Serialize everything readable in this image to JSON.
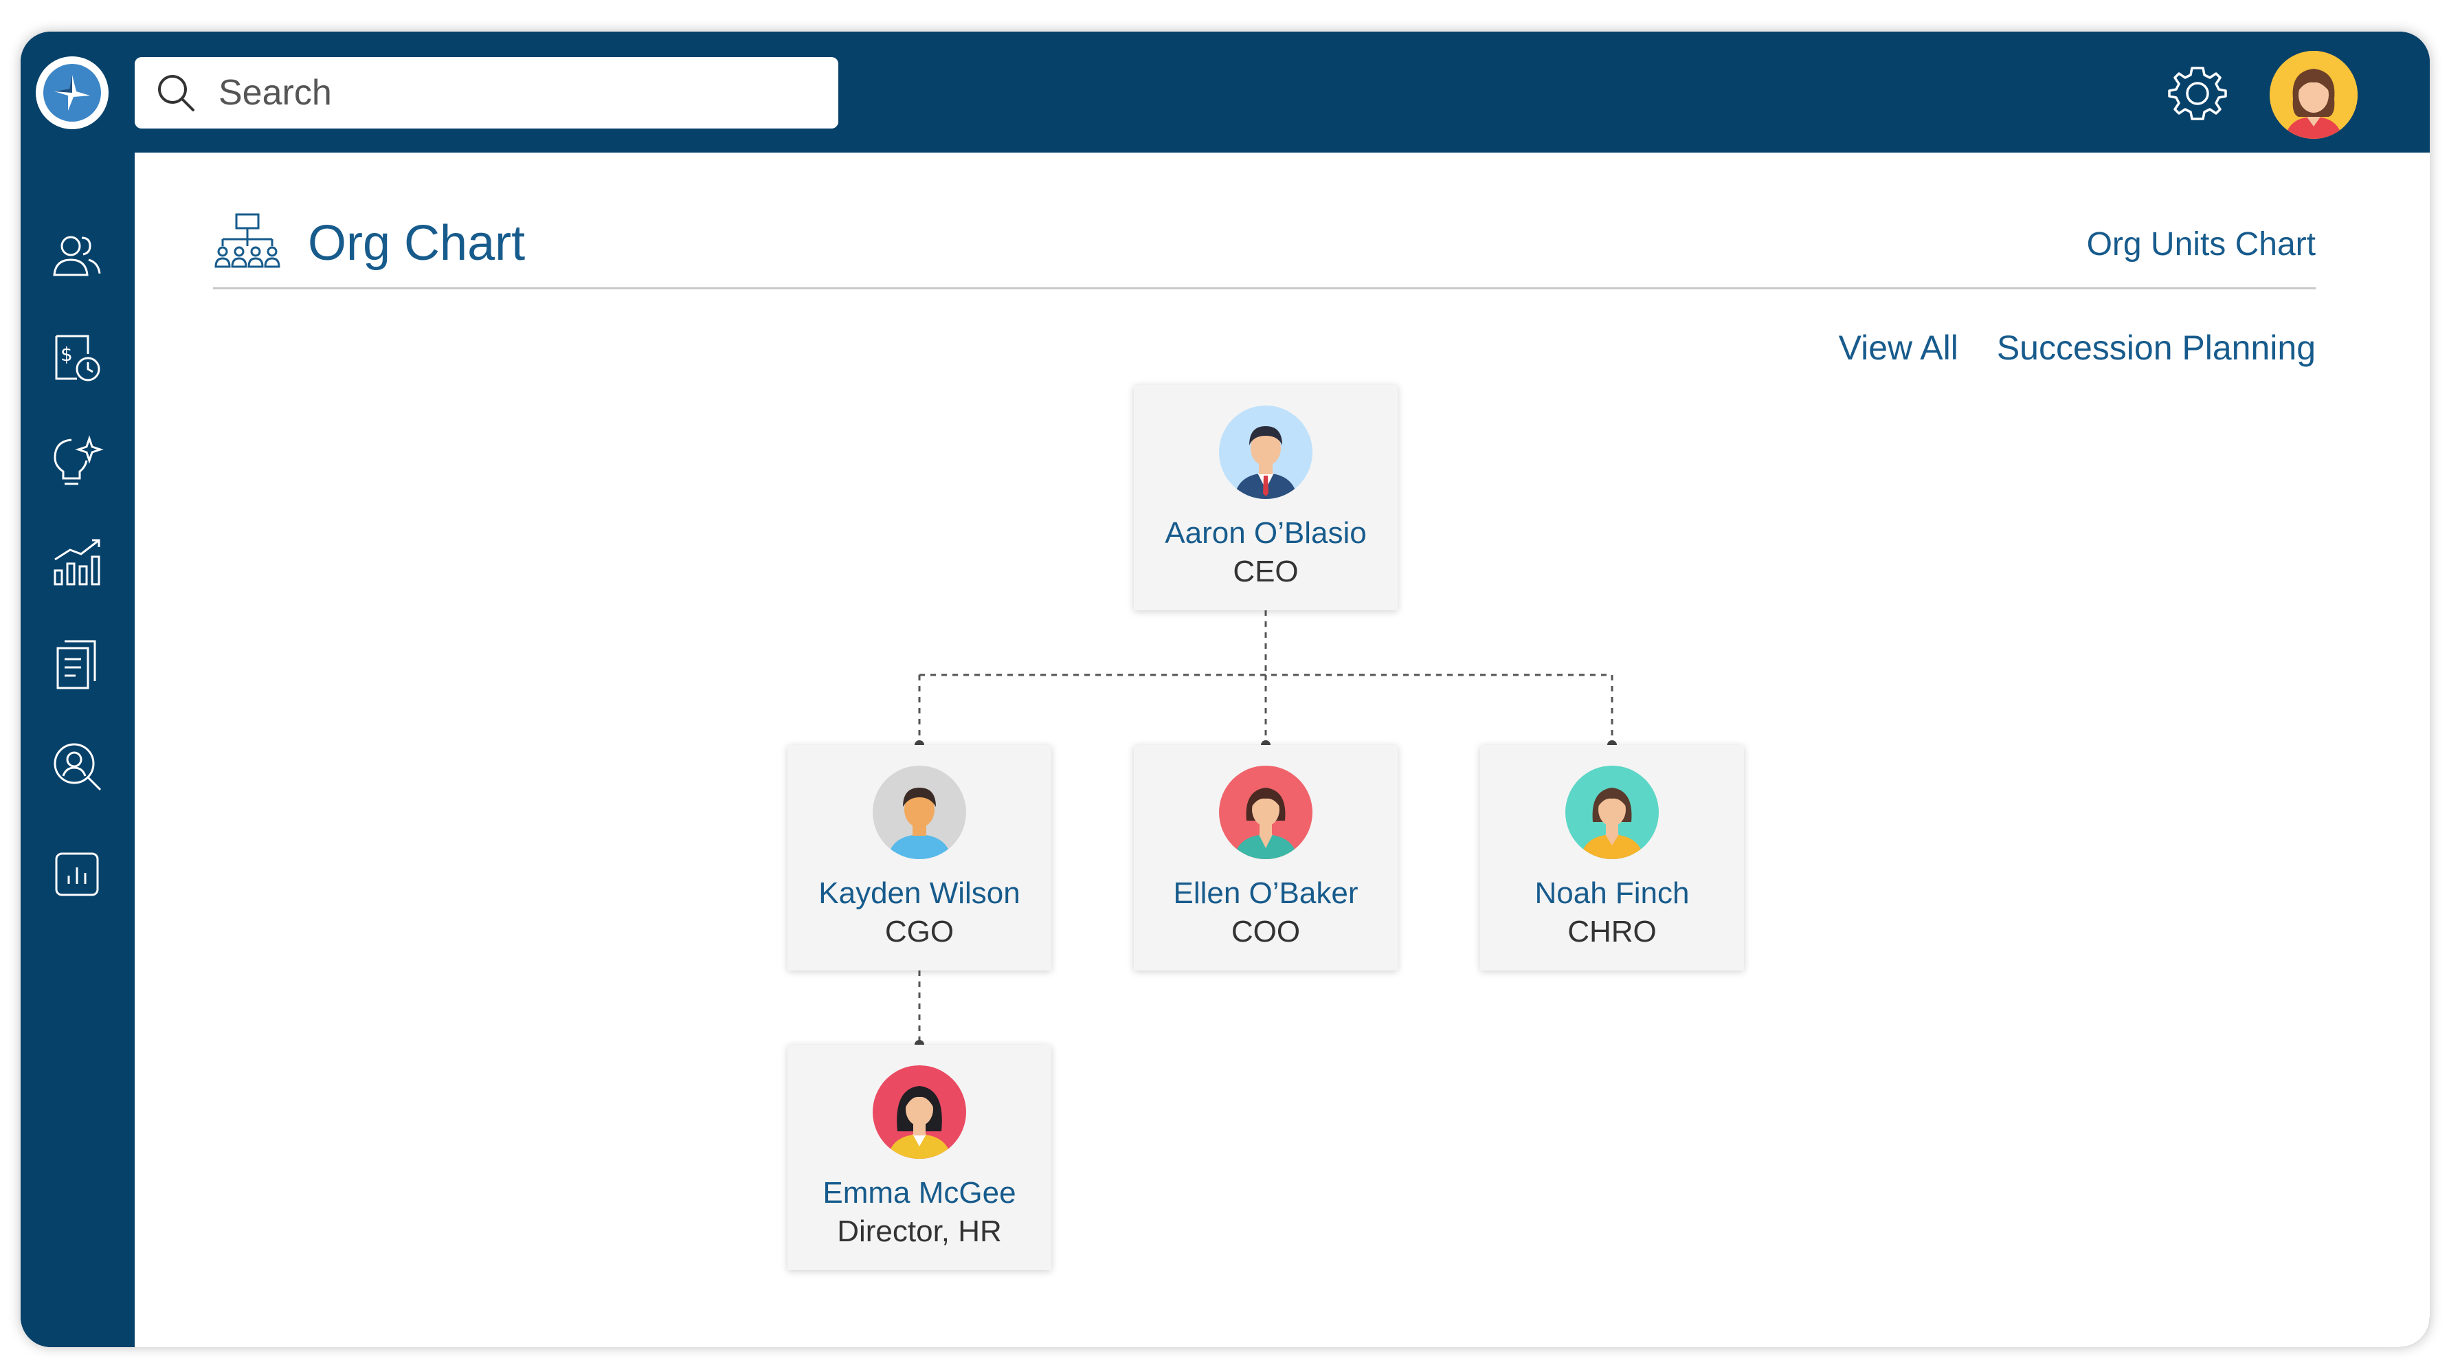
{
  "topbar": {
    "logo_icon": "compass-logo-icon",
    "search": {
      "placeholder": "Search",
      "value": ""
    },
    "settings_icon": "gear-icon",
    "user_avatar_icon": "user-avatar-icon"
  },
  "sidebar": {
    "items": [
      {
        "icon": "people-icon"
      },
      {
        "icon": "payroll-icon"
      },
      {
        "icon": "ideas-icon"
      },
      {
        "icon": "growth-chart-icon"
      },
      {
        "icon": "documents-icon"
      },
      {
        "icon": "user-search-icon"
      },
      {
        "icon": "reports-icon"
      }
    ]
  },
  "page": {
    "title": "Org Chart",
    "units_link": "Org Units Chart",
    "actions": {
      "view_all": "View All",
      "succession": "Succession Planning"
    }
  },
  "org": {
    "ceo": {
      "name": "Aaron O’Blasio",
      "role": "CEO"
    },
    "cgo": {
      "name": "Kayden Wilson",
      "role": "CGO"
    },
    "coo": {
      "name": "Ellen O’Baker",
      "role": "COO"
    },
    "chro": {
      "name": "Noah Finch",
      "role": "CHRO"
    },
    "director_hr": {
      "name": "Emma McGee",
      "role": "Director, HR"
    }
  },
  "colors": {
    "brand": "#06416a",
    "link": "#175b8c",
    "card_bg": "#f4f4f4"
  }
}
